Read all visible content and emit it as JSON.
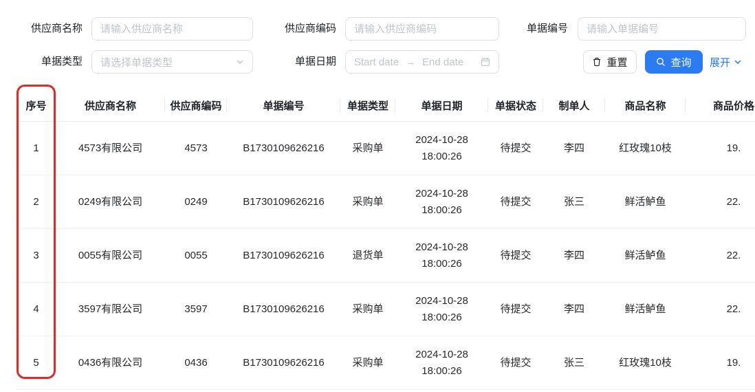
{
  "accent_color": "#2b7bf2",
  "annotation_color": "#e02929",
  "filters": {
    "supplier_name": {
      "label": "供应商名称",
      "placeholder": "请输入供应商名称"
    },
    "supplier_code": {
      "label": "供应商编码",
      "placeholder": "请输入供应商编码"
    },
    "doc_no": {
      "label": "单据编号",
      "placeholder": "请输入单据编号"
    },
    "doc_type": {
      "label": "单据类型",
      "placeholder": "请选择单据类型"
    },
    "doc_date": {
      "label": "单据日期",
      "start_placeholder": "Start date",
      "end_placeholder": "End date",
      "arrow": "→"
    }
  },
  "actions": {
    "reset": "重置",
    "search": "查询",
    "expand": "展开"
  },
  "table": {
    "columns": [
      "序号",
      "供应商名称",
      "供应商编码",
      "单据编号",
      "单据类型",
      "单据日期",
      "单据状态",
      "制单人",
      "商品名称",
      "商品价格"
    ],
    "rows": [
      {
        "seq": "1",
        "supplier_name": "4573有限公司",
        "supplier_code": "4573",
        "doc_no": "B1730109626216",
        "doc_type": "采购单",
        "date": "2024-10-28",
        "time": "18:00:26",
        "status": "待提交",
        "creator": "李四",
        "product": "红玫瑰10枝",
        "price": "19."
      },
      {
        "seq": "2",
        "supplier_name": "0249有限公司",
        "supplier_code": "0249",
        "doc_no": "B1730109626216",
        "doc_type": "采购单",
        "date": "2024-10-28",
        "time": "18:00:26",
        "status": "待提交",
        "creator": "张三",
        "product": "鲜活鲈鱼",
        "price": "22."
      },
      {
        "seq": "3",
        "supplier_name": "0055有限公司",
        "supplier_code": "0055",
        "doc_no": "B1730109626216",
        "doc_type": "退货单",
        "date": "2024-10-28",
        "time": "18:00:26",
        "status": "待提交",
        "creator": "李四",
        "product": "鲜活鲈鱼",
        "price": "22."
      },
      {
        "seq": "4",
        "supplier_name": "3597有限公司",
        "supplier_code": "3597",
        "doc_no": "B1730109626216",
        "doc_type": "采购单",
        "date": "2024-10-28",
        "time": "18:00:26",
        "status": "待提交",
        "creator": "李四",
        "product": "鲜活鲈鱼",
        "price": "22."
      },
      {
        "seq": "5",
        "supplier_name": "0436有限公司",
        "supplier_code": "0436",
        "doc_no": "B1730109626216",
        "doc_type": "采购单",
        "date": "2024-10-28",
        "time": "18:00:26",
        "status": "待提交",
        "creator": "张三",
        "product": "红玫瑰10枝",
        "price": "19."
      }
    ]
  }
}
